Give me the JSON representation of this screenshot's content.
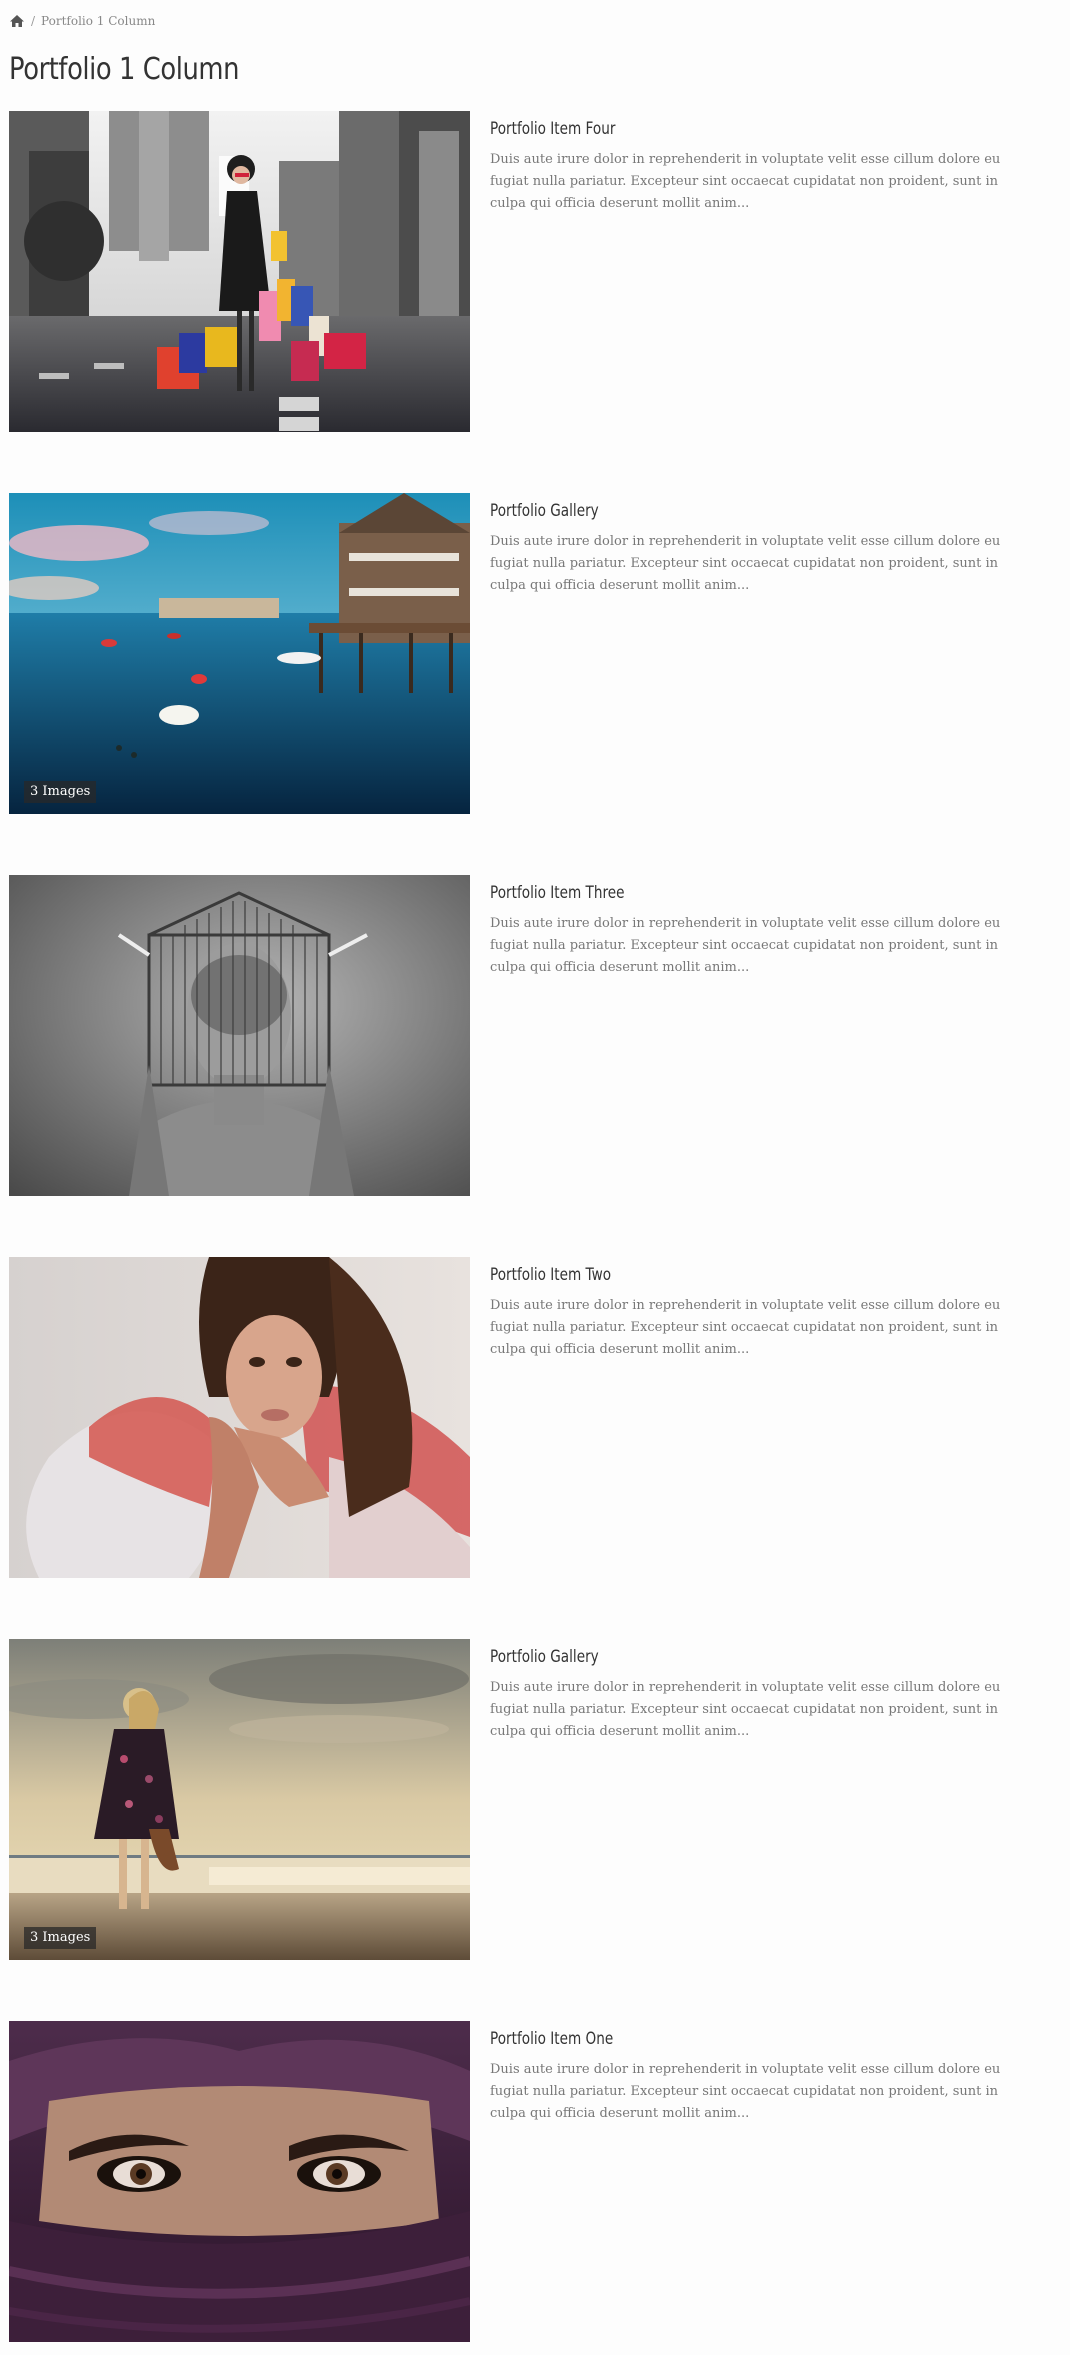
{
  "breadcrumb": {
    "home_icon": "home-icon",
    "separator": "/",
    "current": "Portfolio 1 Column"
  },
  "page_title": "Portfolio 1 Column",
  "items": [
    {
      "title": "Portfolio Item Four",
      "excerpt": "Duis aute irure dolor in reprehenderit in voluptate velit esse cillum dolore eu fugiat nulla pariatur. Excepteur sint occaecat cupidatat non proident, sunt in culpa qui officia deserunt mollit anim...",
      "image_badge": null
    },
    {
      "title": "Portfolio Gallery",
      "excerpt": "Duis aute irure dolor in reprehenderit in voluptate velit esse cillum dolore eu fugiat nulla pariatur. Excepteur sint occaecat cupidatat non proident, sunt in culpa qui officia deserunt mollit anim...",
      "image_badge": "3 Images"
    },
    {
      "title": "Portfolio Item Three",
      "excerpt": "Duis aute irure dolor in reprehenderit in voluptate velit esse cillum dolore eu fugiat nulla pariatur. Excepteur sint occaecat cupidatat non proident, sunt in culpa qui officia deserunt mollit anim...",
      "image_badge": null
    },
    {
      "title": "Portfolio Item Two",
      "excerpt": "Duis aute irure dolor in reprehenderit in voluptate velit esse cillum dolore eu fugiat nulla pariatur. Excepteur sint occaecat cupidatat non proident, sunt in culpa qui officia deserunt mollit anim...",
      "image_badge": null
    },
    {
      "title": "Portfolio Gallery",
      "excerpt": "Duis aute irure dolor in reprehenderit in voluptate velit esse cillum dolore eu fugiat nulla pariatur. Excepteur sint occaecat cupidatat non proident, sunt in culpa qui officia deserunt mollit anim...",
      "image_badge": "3 Images"
    },
    {
      "title": "Portfolio Item One",
      "excerpt": "Duis aute irure dolor in reprehenderit in voluptate velit esse cillum dolore eu fugiat nulla pariatur. Excepteur sint occaecat cupidatat non proident, sunt in culpa qui officia deserunt mollit anim...",
      "image_badge": null
    }
  ],
  "colors": {
    "title": "#333333",
    "excerpt": "#777777",
    "breadcrumb": "#888888",
    "badge_bg": "#282828"
  }
}
